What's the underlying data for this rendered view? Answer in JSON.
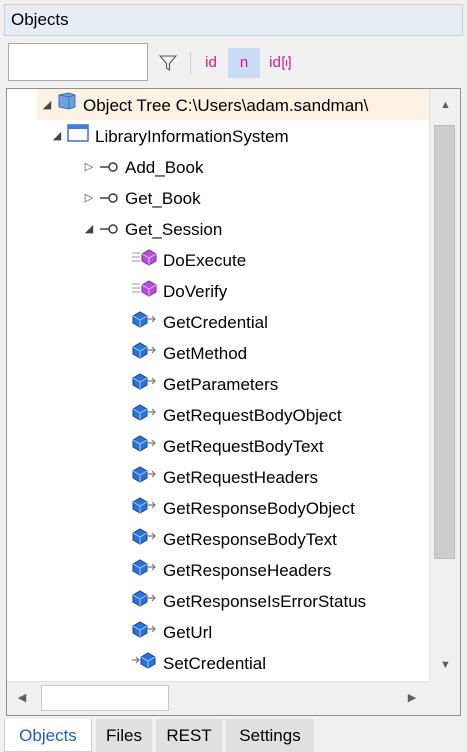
{
  "title": "Objects",
  "toolbar": {
    "search_value": "",
    "filter_icon": "filter-funnel-icon",
    "id_label": "id",
    "n_label": "n",
    "id_index_label": "id",
    "accent_color": "#d0188c"
  },
  "tree": {
    "items": [
      {
        "label": "Object Tree C:\\Users\\adam.sandman\\",
        "icon": "database-icon",
        "expander": "expanded",
        "depth": 0,
        "selected": true
      },
      {
        "label": "LibraryInformationSystem",
        "icon": "window-icon",
        "expander": "expanded",
        "depth": 1
      },
      {
        "label": "Add_Book",
        "icon": "connector-icon",
        "expander": "collapsed",
        "depth": 2
      },
      {
        "label": "Get_Book",
        "icon": "connector-icon",
        "expander": "collapsed",
        "depth": 2
      },
      {
        "label": "Get_Session",
        "icon": "connector-icon",
        "expander": "expanded",
        "depth": 2
      },
      {
        "label": "DoExecute",
        "icon": "action-gem-icon",
        "depth": 3
      },
      {
        "label": "DoVerify",
        "icon": "action-gem-icon",
        "depth": 3
      },
      {
        "label": "GetCredential",
        "icon": "getter-icon",
        "depth": 3
      },
      {
        "label": "GetMethod",
        "icon": "getter-icon",
        "depth": 3
      },
      {
        "label": "GetParameters",
        "icon": "getter-icon",
        "depth": 3
      },
      {
        "label": "GetRequestBodyObject",
        "icon": "getter-icon",
        "depth": 3
      },
      {
        "label": "GetRequestBodyText",
        "icon": "getter-icon",
        "depth": 3
      },
      {
        "label": "GetRequestHeaders",
        "icon": "getter-icon",
        "depth": 3
      },
      {
        "label": "GetResponseBodyObject",
        "icon": "getter-icon",
        "depth": 3
      },
      {
        "label": "GetResponseBodyText",
        "icon": "getter-icon",
        "depth": 3
      },
      {
        "label": "GetResponseHeaders",
        "icon": "getter-icon",
        "depth": 3
      },
      {
        "label": "GetResponseIsErrorStatus",
        "icon": "getter-icon",
        "depth": 3
      },
      {
        "label": "GetUrl",
        "icon": "getter-icon",
        "depth": 3
      },
      {
        "label": "SetCredential",
        "icon": "setter-icon",
        "depth": 3
      }
    ]
  },
  "tabs": [
    {
      "label": "Objects",
      "active": true
    },
    {
      "label": "Files",
      "active": false
    },
    {
      "label": "REST",
      "active": false
    },
    {
      "label": "Settings",
      "active": false
    }
  ]
}
